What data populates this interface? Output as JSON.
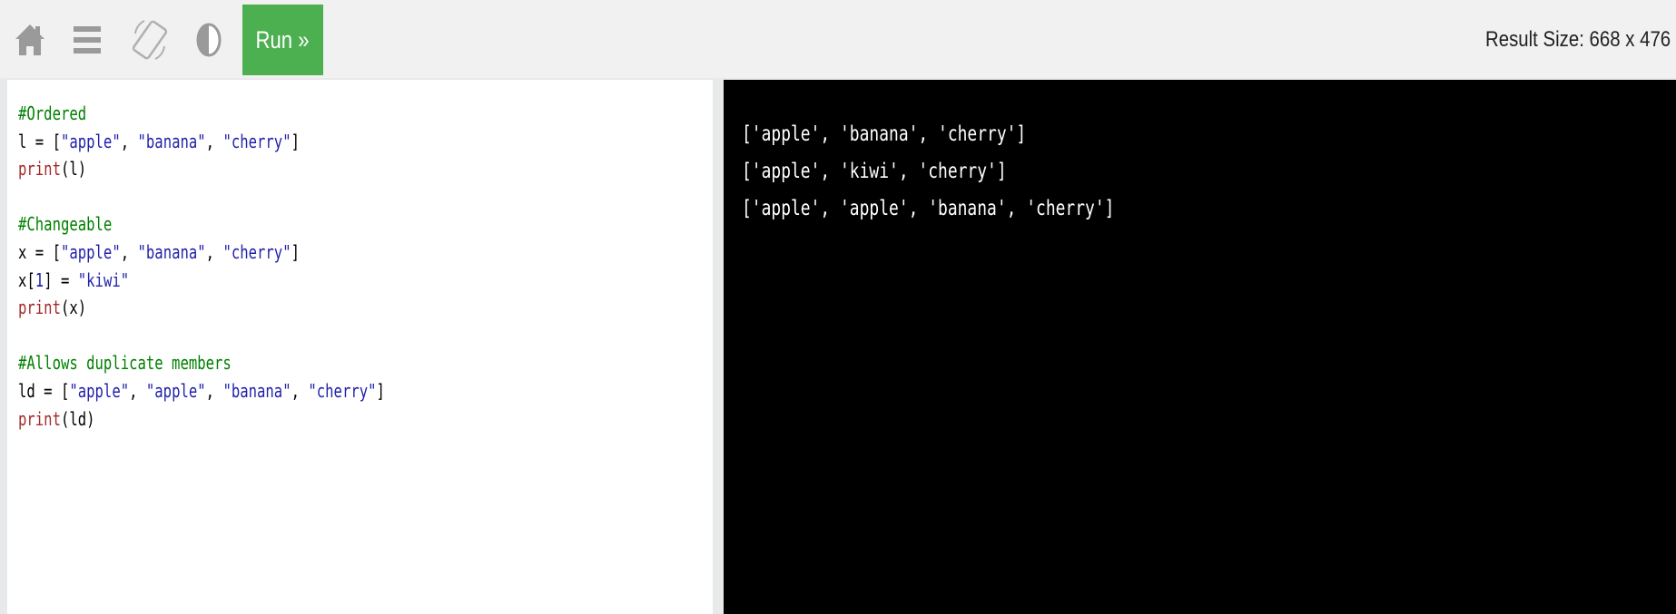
{
  "toolbar": {
    "icons": [
      "home-icon",
      "menu-icon",
      "rotate-icon",
      "theme-icon"
    ],
    "run_label": "Run »",
    "run_color": "#4caf50",
    "result_size": "Result Size: 668 x 476"
  },
  "editor": {
    "lines": [
      [
        {
          "t": "comment",
          "v": "#Ordered"
        }
      ],
      [
        {
          "t": "txt",
          "v": "l = ["
        },
        {
          "t": "str",
          "v": "\"apple\""
        },
        {
          "t": "txt",
          "v": ", "
        },
        {
          "t": "str",
          "v": "\"banana\""
        },
        {
          "t": "txt",
          "v": ", "
        },
        {
          "t": "str",
          "v": "\"cherry\""
        },
        {
          "t": "txt",
          "v": "]"
        }
      ],
      [
        {
          "t": "fn",
          "v": "print"
        },
        {
          "t": "txt",
          "v": "(l)"
        }
      ],
      [],
      [
        {
          "t": "comment",
          "v": "#Changeable"
        }
      ],
      [
        {
          "t": "txt",
          "v": "x = ["
        },
        {
          "t": "str",
          "v": "\"apple\""
        },
        {
          "t": "txt",
          "v": ", "
        },
        {
          "t": "str",
          "v": "\"banana\""
        },
        {
          "t": "txt",
          "v": ", "
        },
        {
          "t": "str",
          "v": "\"cherry\""
        },
        {
          "t": "txt",
          "v": "]"
        }
      ],
      [
        {
          "t": "txt",
          "v": "x["
        },
        {
          "t": "str",
          "v": "1"
        },
        {
          "t": "txt",
          "v": "] = "
        },
        {
          "t": "str",
          "v": "\"kiwi\""
        }
      ],
      [
        {
          "t": "fn",
          "v": "print"
        },
        {
          "t": "txt",
          "v": "(x)"
        }
      ],
      [],
      [
        {
          "t": "comment",
          "v": "#Allows duplicate members"
        }
      ],
      [
        {
          "t": "txt",
          "v": "ld = ["
        },
        {
          "t": "str",
          "v": "\"apple\""
        },
        {
          "t": "txt",
          "v": ", "
        },
        {
          "t": "str",
          "v": "\"apple\""
        },
        {
          "t": "txt",
          "v": ", "
        },
        {
          "t": "str",
          "v": "\"banana\""
        },
        {
          "t": "txt",
          "v": ", "
        },
        {
          "t": "str",
          "v": "\"cherry\""
        },
        {
          "t": "txt",
          "v": "]"
        }
      ],
      [
        {
          "t": "fn",
          "v": "print"
        },
        {
          "t": "txt",
          "v": "(ld)"
        }
      ]
    ]
  },
  "output": {
    "lines": [
      "['apple', 'banana', 'cherry']",
      "['apple', 'kiwi', 'cherry']",
      "['apple', 'apple', 'banana', 'cherry']"
    ]
  }
}
